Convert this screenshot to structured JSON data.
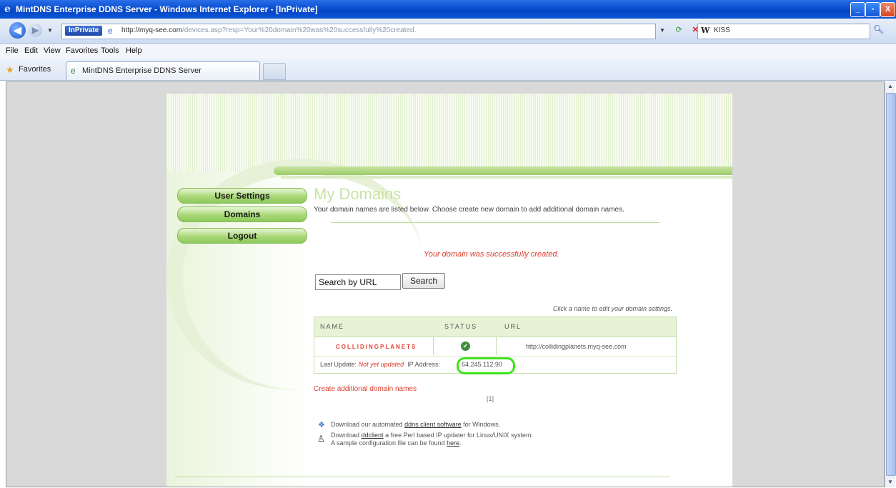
{
  "window": {
    "title": "MintDNS Enterprise DDNS Server - Windows Internet Explorer - [InPrivate]",
    "minimize": "_",
    "maximize": "▫",
    "close": "X"
  },
  "addressbar": {
    "inprivate": "InPrivate",
    "url_domain": "http://myq-see.com",
    "url_path": "/devices.asp?resp=Your%20domain%20was%20successfully%20created.",
    "search_value": "KISS"
  },
  "menu": [
    "File",
    "Edit",
    "View",
    "Favorites",
    "Tools",
    "Help"
  ],
  "favorites": {
    "label": "Favorites",
    "tab_title": "MintDNS Enterprise DDNS Server"
  },
  "sidebar": {
    "items": [
      {
        "label": "User Settings"
      },
      {
        "label": "Domains"
      },
      {
        "label": "Logout"
      }
    ]
  },
  "main": {
    "title": "My Domains",
    "subtitle": "Your domain names are listed below. Choose create new domain to add additional domain names.",
    "success_message": "Your domain was successfully created.",
    "search_placeholder": "Search by URL",
    "search_button": "Search",
    "hint": "Click a name to edit your domain settings.",
    "table": {
      "columns": [
        "NAME",
        "STATUS",
        "URL"
      ],
      "row": {
        "name": "COLLIDINGPLANETS",
        "url": "http://collidingplanets.myq-see.com",
        "last_update_label": "Last Update:",
        "last_update_value": "Not yet updated",
        "ip_label": "IP Address:",
        "ip_value": "64.245.112.90"
      }
    },
    "create_link": "Create additional domain names",
    "pager": "[1]",
    "download1": {
      "prefix": "Download our automated ",
      "link": "ddns client software",
      "suffix": " for Windows."
    },
    "download2": {
      "prefix": "Download ",
      "link": "ddclient",
      "suffix": " a free Perl based IP updater for Linux/UNIX system.",
      "line2_prefix": "A sample configuration file can be found ",
      "line2_link": "here",
      "line2_suffix": "."
    }
  },
  "colors": {
    "accent_green": "#9dcb6a",
    "error_red": "#e03a2a",
    "highlight_ring": "#3ee21a"
  }
}
